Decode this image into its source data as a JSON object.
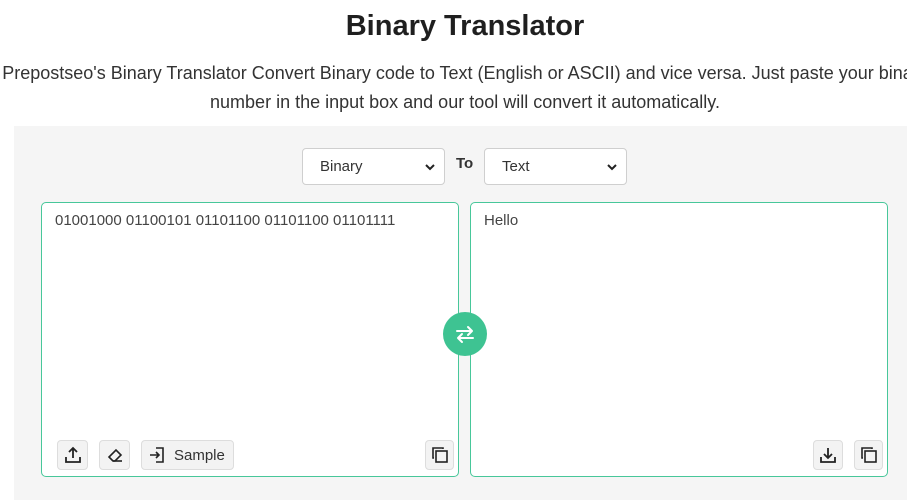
{
  "header": {
    "title": "Binary Translator",
    "description_line1": "Prepostseo's Binary Translator Convert Binary code to Text (English or ASCII) and vice versa. Just paste your binary",
    "description_line2": "number in the input box and our tool will convert it automatically."
  },
  "converter": {
    "from_select": {
      "value": "Binary"
    },
    "to_label": "To",
    "to_select": {
      "value": "Text"
    },
    "input_text": "01001000 01100101 01101100 01101100 01101111",
    "output_text": "Hello",
    "sample_label": "Sample"
  },
  "colors": {
    "accent": "#3ec392",
    "box_border": "#48c79a",
    "panel_bg": "#f5f5f5"
  },
  "icons": {
    "upload": "upload-icon",
    "eraser": "eraser-icon",
    "sample": "import-icon",
    "copy": "copy-icon",
    "download": "download-icon",
    "swap": "swap-arrows-icon"
  }
}
